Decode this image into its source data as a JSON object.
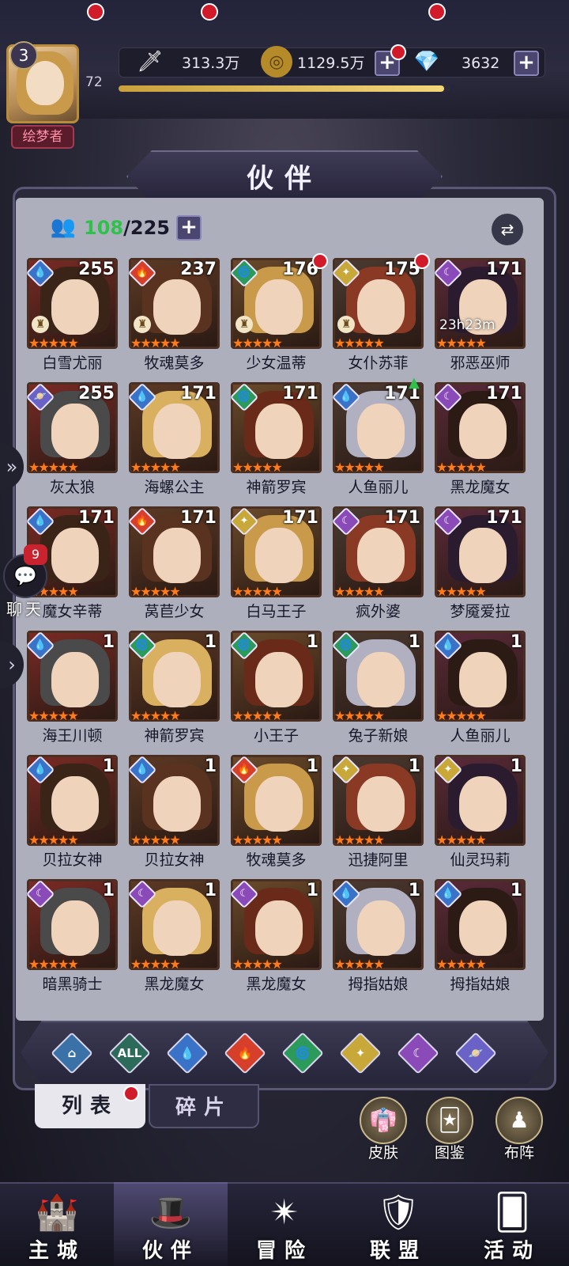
{
  "player": {
    "level": "3",
    "vip": "72",
    "title": "绘梦者"
  },
  "resources": {
    "power": "313.3万",
    "gold": "1129.5万",
    "gems": "3632",
    "exp_fraction": 0.98
  },
  "screen_title": "伙伴",
  "roster": {
    "owned": "108",
    "capacity": "/225"
  },
  "cards": [
    {
      "name": "白雪尤丽",
      "level": "255",
      "element": "water",
      "stars": "★★★★★",
      "dot": false,
      "lock": true
    },
    {
      "name": "牧魂莫多",
      "level": "237",
      "element": "fire",
      "stars": "★★★★★",
      "dot": false,
      "lock": true
    },
    {
      "name": "少女温蒂",
      "level": "176",
      "element": "wind",
      "stars": "★★★★★",
      "dot": true,
      "lock": true
    },
    {
      "name": "女仆苏菲",
      "level": "175",
      "element": "light",
      "stars": "★★★★★",
      "dot": true,
      "lock": true
    },
    {
      "name": "邪恶巫师",
      "level": "171",
      "element": "dark",
      "stars": "★★★★★",
      "dot": false,
      "timer": "23h23m"
    },
    {
      "name": "灰太狼",
      "level": "255",
      "element": "void",
      "stars": "★★★★★"
    },
    {
      "name": "海螺公主",
      "level": "171",
      "element": "water",
      "stars": "★★★★★"
    },
    {
      "name": "神箭罗宾",
      "level": "171",
      "element": "wind",
      "stars": "★★★★★"
    },
    {
      "name": "人鱼丽儿",
      "level": "171",
      "element": "water",
      "stars": "★★★★★",
      "up": true
    },
    {
      "name": "黑龙魔女",
      "level": "171",
      "element": "dark",
      "stars": "★★★★★"
    },
    {
      "name": "魔女辛蒂",
      "level": "171",
      "element": "water",
      "stars": "★★★★★"
    },
    {
      "name": "莴苣少女",
      "level": "171",
      "element": "fire",
      "stars": "★★★★★"
    },
    {
      "name": "白马王子",
      "level": "171",
      "element": "light",
      "stars": "★★★★★"
    },
    {
      "name": "疯外婆",
      "level": "171",
      "element": "dark",
      "stars": "★★★★★"
    },
    {
      "name": "梦魇爱拉",
      "level": "171",
      "element": "dark",
      "stars": "★★★★★"
    },
    {
      "name": "海王川顿",
      "level": "1",
      "element": "water",
      "stars": "★★★★★"
    },
    {
      "name": "神箭罗宾",
      "level": "1",
      "element": "wind",
      "stars": "★★★★★"
    },
    {
      "name": "小王子",
      "level": "1",
      "element": "wind",
      "stars": "★★★★★"
    },
    {
      "name": "兔子新娘",
      "level": "1",
      "element": "wind",
      "stars": "★★★★★"
    },
    {
      "name": "人鱼丽儿",
      "level": "1",
      "element": "water",
      "stars": "★★★★★"
    },
    {
      "name": "贝拉女神",
      "level": "1",
      "element": "water",
      "stars": "★★★★★"
    },
    {
      "name": "贝拉女神",
      "level": "1",
      "element": "water",
      "stars": "★★★★★"
    },
    {
      "name": "牧魂莫多",
      "level": "1",
      "element": "fire",
      "stars": "★★★★★"
    },
    {
      "name": "迅捷阿里",
      "level": "1",
      "element": "light",
      "stars": "★★★★★"
    },
    {
      "name": "仙灵玛莉",
      "level": "1",
      "element": "light",
      "stars": "★★★★★"
    },
    {
      "name": "暗黑骑士",
      "level": "1",
      "element": "dark",
      "stars": "★★★★★"
    },
    {
      "name": "黑龙魔女",
      "level": "1",
      "element": "dark",
      "stars": "★★★★★"
    },
    {
      "name": "黑龙魔女",
      "level": "1",
      "element": "dark",
      "stars": "★★★★★"
    },
    {
      "name": "拇指姑娘",
      "level": "1",
      "element": "water",
      "stars": "★★★★★"
    },
    {
      "name": "拇指姑娘",
      "level": "1",
      "element": "water",
      "stars": "★★★★★"
    }
  ],
  "filters": [
    "",
    "ALL",
    "",
    "",
    "",
    "",
    "",
    ""
  ],
  "tabs": {
    "list": "列表",
    "fragments": "碎片"
  },
  "side_buttons": {
    "skin": "皮肤",
    "codex": "图鉴",
    "formation": "布阵"
  },
  "chat": {
    "label": "聊天",
    "badge": "9"
  },
  "nav": {
    "city": "主城",
    "partner": "伙伴",
    "adventure": "冒险",
    "alliance": "联盟",
    "events": "活动"
  },
  "colors": {
    "water": "#3a72c8",
    "fire": "#d6402a",
    "wind": "#2c9a5a",
    "light": "#c9a83a",
    "dark": "#8a4ab8",
    "void": "#6b62c8",
    "accent_red": "#d11a2a"
  }
}
